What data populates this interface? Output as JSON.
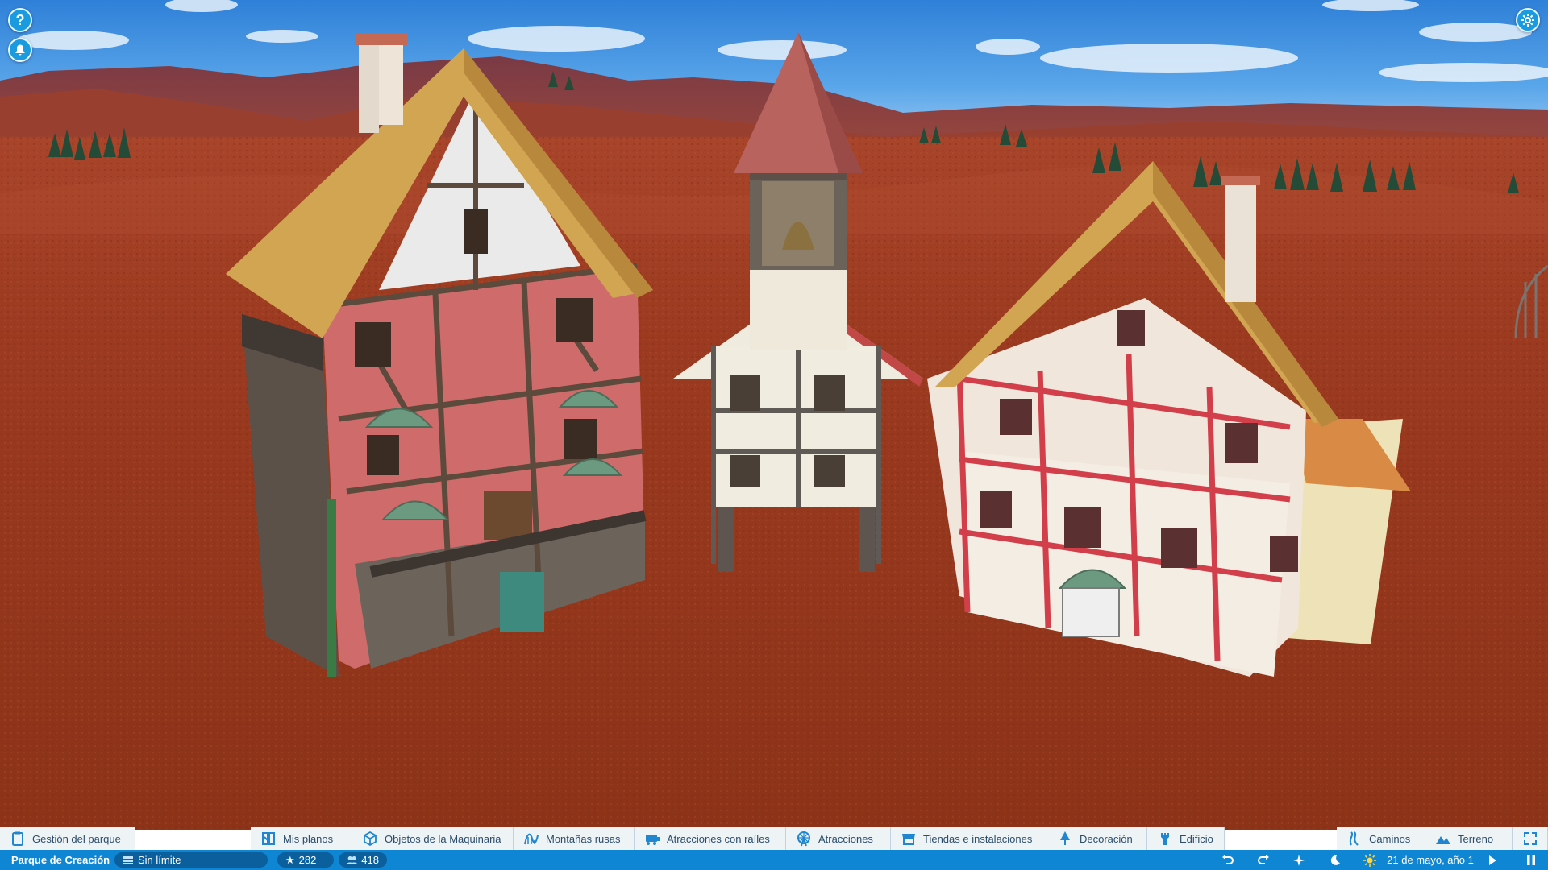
{
  "park": {
    "name": "Parque de Creación",
    "money": "Sin límite",
    "rating": "282",
    "guests": "418",
    "date": "21 de mayo, año 1"
  },
  "toolbar": {
    "park_management": "Gestión del parque",
    "items": [
      {
        "label": "Mis planos",
        "icon": "blueprint-icon"
      },
      {
        "label": "Objetos de la Maquinaria",
        "icon": "cube-icon"
      },
      {
        "label": "Montañas rusas",
        "icon": "coaster-icon"
      },
      {
        "label": "Atracciones con raíles",
        "icon": "train-icon"
      },
      {
        "label": "Atracciones",
        "icon": "ferris-wheel-icon"
      },
      {
        "label": "Tiendas e instalaciones",
        "icon": "shop-icon"
      },
      {
        "label": "Decoración",
        "icon": "tree-icon"
      },
      {
        "label": "Edificio",
        "icon": "tower-icon"
      }
    ],
    "paths": "Caminos",
    "terrain": "Terreno"
  },
  "top_buttons": {
    "help": "?",
    "notifications": "bell-icon",
    "settings": "gear-icon"
  },
  "colors": {
    "toolbar_bg": "#eef3f6",
    "toolbar_text": "#2b4d6a",
    "statusbar_bg": "#0e86d4",
    "accent": "#1a9be0"
  }
}
